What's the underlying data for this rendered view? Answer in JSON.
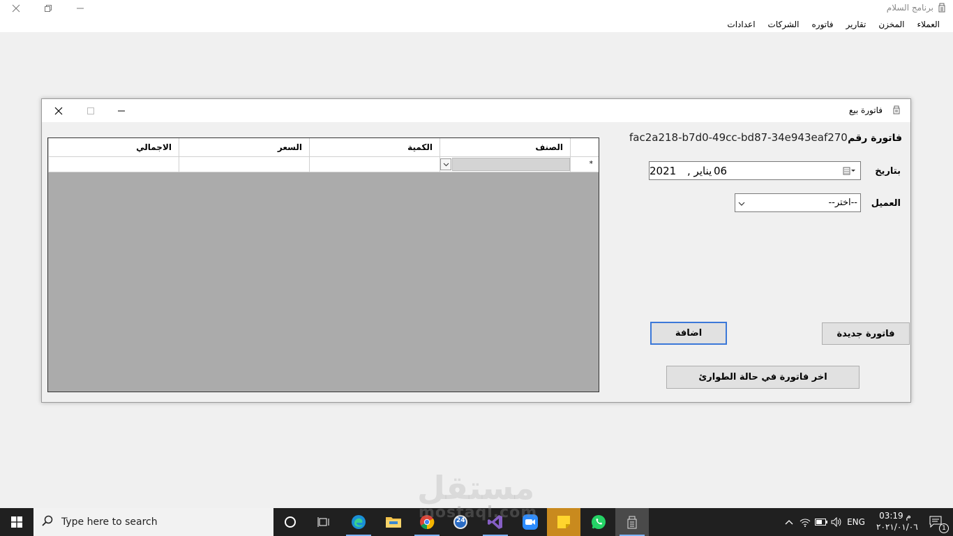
{
  "app": {
    "title": "برنامج السلام",
    "menu": [
      "العملاء",
      "المخزن",
      "تقارير",
      "فاتوره",
      "الشركات",
      "اعدادات"
    ]
  },
  "dialog": {
    "title": "فاتورة بيع",
    "grid": {
      "columns": [
        "الصنف",
        "الكمية",
        "السعر",
        "الاجمالي"
      ],
      "new_row_marker": "*"
    },
    "form": {
      "invoice_label": "فاتورة رقم",
      "invoice_number": "fac2a218-b7d0-49cc-bd87-34e943eaf270",
      "date_label": "بتاريخ",
      "date_day": "06",
      "date_month": "يناير ,",
      "date_year": "2021",
      "customer_label": "العميل",
      "customer_value": "--اختر--"
    },
    "buttons": {
      "new_invoice": "فاتورة جديدة",
      "add": "اضافة",
      "last_emergency_invoice": "اخر فاتورة في حالة الطوارئ"
    }
  },
  "watermark": {
    "text": "مستقل",
    "sub": "mostaql.com"
  },
  "taskbar": {
    "search_placeholder": "Type here to search",
    "language": "ENG",
    "time": "03:19 م",
    "date": "٢٠٢١/٠١/٠٦",
    "notification_count": "1",
    "calendar_badge": "24"
  }
}
